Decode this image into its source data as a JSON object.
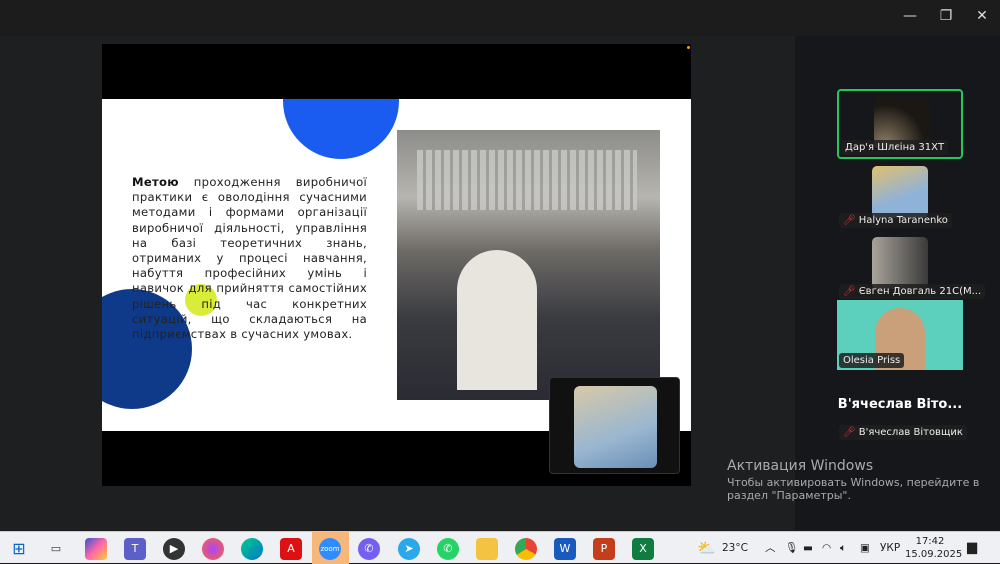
{
  "window": {
    "minimize_icon": "minimize-icon",
    "restore_icon": "restore-icon",
    "close_icon": "close-icon"
  },
  "slide": {
    "heading_bold": "Метою",
    "body": " проходження виробничої практики є оволодіння сучасними методами і формами організації виробничої діяльності, управління  на базі теоретичних знань, отриманих у процесі навчання, набуття професійних умінь і навичок для прийняття самостійних рішень під час конкретних ситуацій, що складаються на підприємствах в сучасних умовах."
  },
  "participants": [
    {
      "name": "Дар'я Шлєіна 31ХТ",
      "muted": false,
      "active": true
    },
    {
      "name": "Halyna Taranenko",
      "muted": true
    },
    {
      "name": "Євген Довгаль 21С(М...",
      "muted": true
    },
    {
      "name": "Olesia Priss",
      "muted": false
    },
    {
      "name": "В'ячеслав Вітовщик",
      "display_title": "В'ячеслав  Віто...",
      "muted": true
    }
  ],
  "activation": {
    "title": "Активация Windows",
    "line1": "Чтобы активировать Windows, перейдите в",
    "line2": "раздел \"Параметры\"."
  },
  "taskbar": {
    "apps": [
      "Windows",
      "Task View",
      "Copilot",
      "Teams",
      "Media Player",
      "Firefox",
      "Edge",
      "Acrobat",
      "Zoom",
      "Viber",
      "Telegram",
      "WhatsApp",
      "File Explorer",
      "Chrome",
      "Word",
      "PowerPoint",
      "Excel"
    ],
    "zoom_label": "zoom",
    "weather": "23°C",
    "lang": "УКР",
    "time": "17:42",
    "date": "15.09.2025"
  },
  "colors": {
    "active_border": "#22c55e",
    "accent_blue": "#1a5cf0",
    "navy": "#0f3a8a",
    "lime": "#d9ec3a"
  }
}
